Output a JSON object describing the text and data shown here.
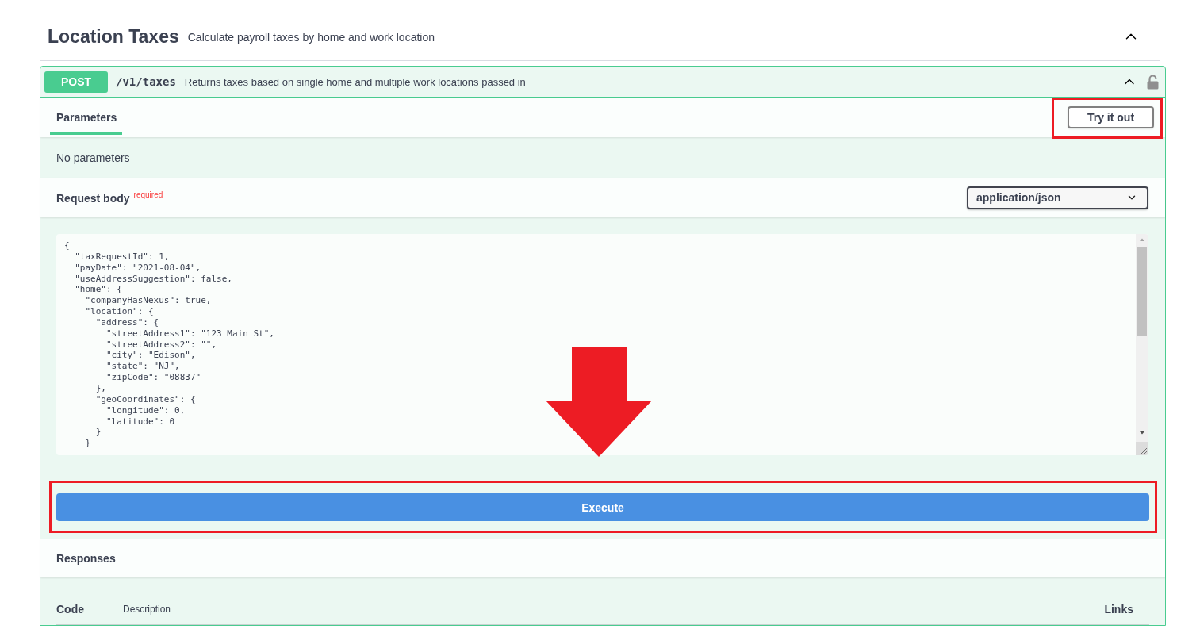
{
  "section": {
    "title": "Location Taxes",
    "description": "Calculate payroll taxes by home and work location",
    "expanded": true
  },
  "operation": {
    "method": "POST",
    "path": "/v1/taxes",
    "summary": "Returns taxes based on single home and multiple work locations passed in",
    "expanded": true,
    "locked": false
  },
  "parameters": {
    "tabs": [
      {
        "label": "Parameters",
        "selected": true
      }
    ],
    "try_it_out": {
      "label": "Try it out",
      "highlighted": true
    },
    "message": "No parameters"
  },
  "request_body": {
    "title": "Request body",
    "required_label": "required",
    "content_type": "application/json",
    "value": "{\n  \"taxRequestId\": 1,\n  \"payDate\": \"2021-08-04\",\n  \"useAddressSuggestion\": false,\n  \"home\": {\n    \"companyHasNexus\": true,\n    \"location\": {\n      \"address\": {\n        \"streetAddress1\": \"123 Main St\",\n        \"streetAddress2\": \"\",\n        \"city\": \"Edison\",\n        \"state\": \"NJ\",\n        \"zipCode\": \"08837\"\n      },\n      \"geoCoordinates\": {\n        \"longitude\": 0,\n        \"latitude\": 0\n      }\n    }",
    "pointer_arrow": true
  },
  "execute": {
    "label": "Execute",
    "highlighted": true
  },
  "responses": {
    "title": "Responses",
    "columns": [
      {
        "label": "Code",
        "kind": "primary"
      },
      {
        "label": "Description",
        "kind": "secondary"
      },
      {
        "label": "Links",
        "kind": "primary"
      }
    ]
  }
}
